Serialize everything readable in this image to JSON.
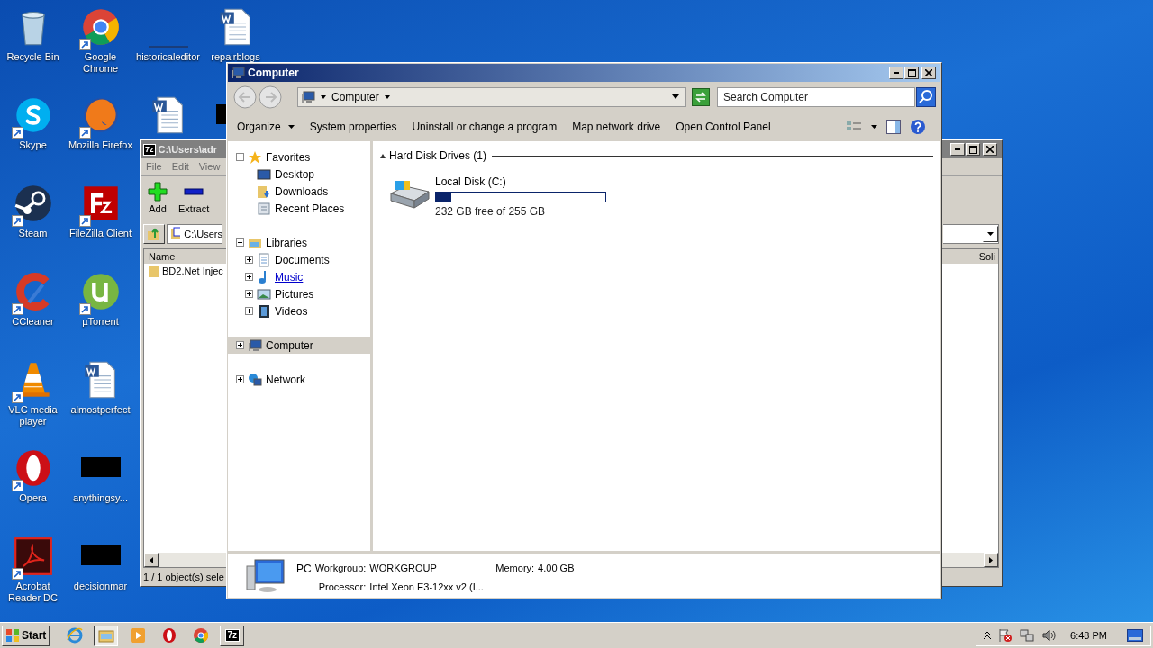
{
  "desktop": {
    "columns": [
      [
        {
          "label": "Recycle Bin",
          "kind": "recycle",
          "shortcut": false
        },
        {
          "label": "Skype",
          "kind": "skype",
          "shortcut": true
        },
        {
          "label": "Steam",
          "kind": "steam",
          "shortcut": true
        },
        {
          "label": "CCleaner",
          "kind": "ccleaner",
          "shortcut": true
        },
        {
          "label": "VLC media player",
          "kind": "vlc",
          "shortcut": true
        },
        {
          "label": "Opera",
          "kind": "opera",
          "shortcut": true
        },
        {
          "label": "Acrobat Reader DC",
          "kind": "acrobat",
          "shortcut": true
        }
      ],
      [
        {
          "label": "Google Chrome",
          "kind": "chrome",
          "shortcut": true
        },
        {
          "label": "Mozilla Firefox",
          "kind": "firefox",
          "shortcut": true
        },
        {
          "label": "FileZilla Client",
          "kind": "filezilla",
          "shortcut": true
        },
        {
          "label": "µTorrent",
          "kind": "utorrent",
          "shortcut": true
        },
        {
          "label": "almostperfect",
          "kind": "word",
          "shortcut": false
        },
        {
          "label": "anythingsy...",
          "kind": "redacted",
          "shortcut": false
        },
        {
          "label": "decisionmar",
          "kind": "redacted",
          "shortcut": false
        }
      ],
      [
        {
          "label": "historicaleditor",
          "kind": "blank",
          "shortcut": false
        },
        {
          "kind": "word",
          "shortcut": false
        }
      ],
      [
        {
          "label": "repairblogs",
          "kind": "word",
          "shortcut": false
        },
        {
          "kind": "redacted",
          "shortcut": false
        }
      ]
    ]
  },
  "archive_window": {
    "logo": "7z",
    "title": "C:\\Users\\adr",
    "menu": [
      "File",
      "Edit",
      "View"
    ],
    "tools": [
      {
        "label": "Add",
        "kind": "add"
      },
      {
        "label": "Extract",
        "kind": "extract"
      }
    ],
    "address": "C:\\Users",
    "columns": [
      "Name",
      "Soli"
    ],
    "rows": [
      "BD2.Net Injec"
    ],
    "status": "1 / 1 object(s) sele"
  },
  "explorer": {
    "title": "Computer",
    "address": "Computer",
    "search_placeholder": "Search Computer",
    "commands": [
      {
        "label": "Organize",
        "dropdown": true
      },
      {
        "label": "System properties",
        "dropdown": false
      },
      {
        "label": "Uninstall or change a program",
        "dropdown": false
      },
      {
        "label": "Map network drive",
        "dropdown": false
      },
      {
        "label": "Open Control Panel",
        "dropdown": false
      }
    ],
    "nav": [
      {
        "label": "Favorites",
        "kind": "star",
        "expanded": true,
        "selected": false,
        "hovered": false,
        "children": [
          {
            "label": "Desktop",
            "kind": "desktop",
            "selected": false,
            "hovered": false
          },
          {
            "label": "Downloads",
            "kind": "downloads",
            "selected": false,
            "hovered": false
          },
          {
            "label": "Recent Places",
            "kind": "recent",
            "selected": false,
            "hovered": false
          }
        ]
      },
      {
        "label": "Libraries",
        "kind": "library",
        "expanded": true,
        "selected": false,
        "hovered": false,
        "children": [
          {
            "label": "Documents",
            "kind": "document",
            "expanded": false,
            "selected": false,
            "hovered": false
          },
          {
            "label": "Music",
            "kind": "music",
            "expanded": false,
            "selected": false,
            "hovered": true
          },
          {
            "label": "Pictures",
            "kind": "pictures",
            "expanded": false,
            "selected": false,
            "hovered": false
          },
          {
            "label": "Videos",
            "kind": "videos",
            "expanded": false,
            "selected": false,
            "hovered": false
          }
        ]
      },
      {
        "label": "Computer",
        "kind": "computer",
        "expanded": false,
        "selected": true,
        "hovered": false
      },
      {
        "label": "Network",
        "kind": "network",
        "expanded": false,
        "selected": false,
        "hovered": false
      }
    ],
    "group": {
      "title": "Hard Disk Drives (1)",
      "expanded": true
    },
    "drives": [
      {
        "name": "Local Disk (C:)",
        "level": 0.09,
        "free": "232 GB free of 255 GB"
      }
    ],
    "details": {
      "name": "PC",
      "fields": [
        {
          "label": "Workgroup:",
          "value": "WORKGROUP"
        },
        {
          "label": "Memory:",
          "value": "4.00 GB"
        },
        {
          "label": "Processor:",
          "value": "Intel Xeon E3-12xx v2 (I..."
        }
      ]
    }
  },
  "taskbar": {
    "start": "Start",
    "apps": [
      {
        "kind": "ie",
        "active": false
      },
      {
        "kind": "explorer",
        "active": true
      },
      {
        "kind": "media",
        "active": false
      },
      {
        "kind": "opera",
        "active": false
      },
      {
        "kind": "chrome",
        "active": false
      },
      {
        "kind": "sevenzip",
        "active": false,
        "logo": "7z"
      }
    ],
    "clock": "6:48 PM"
  }
}
